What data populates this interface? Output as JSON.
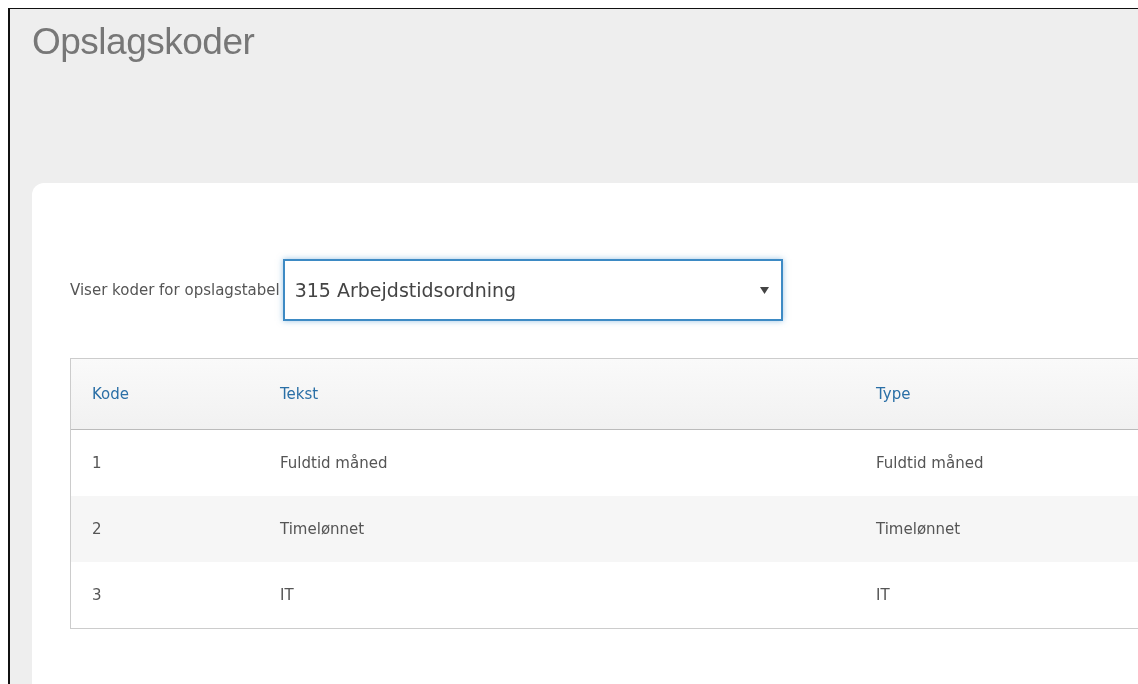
{
  "page": {
    "title": "Opslagskoder"
  },
  "filter": {
    "label": "Viser koder for opslagstabel",
    "value": "315 Arbejdstidsordning"
  },
  "table": {
    "columns": [
      "Kode",
      "Tekst",
      "Type"
    ],
    "rows": [
      {
        "cells": [
          "1",
          "Fuldtid måned",
          "Fuldtid måned"
        ]
      },
      {
        "cells": [
          "2",
          "Timelønnet",
          "Timelønnet"
        ]
      },
      {
        "cells": [
          "3",
          "IT",
          "IT"
        ]
      }
    ]
  }
}
